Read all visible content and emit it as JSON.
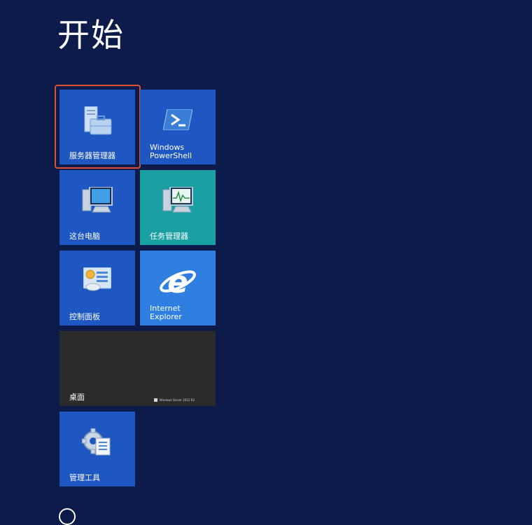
{
  "start": {
    "title": "开始"
  },
  "tiles": {
    "server_manager": {
      "label": "服务器管理器"
    },
    "powershell": {
      "label_line1": "Windows",
      "label_line2": "PowerShell"
    },
    "this_pc": {
      "label": "这台电脑"
    },
    "task_manager": {
      "label": "任务管理器"
    },
    "control_panel": {
      "label": "控制面板"
    },
    "internet_explorer": {
      "label_line1": "Internet",
      "label_line2": "Explorer"
    },
    "desktop": {
      "label": "桌面",
      "os_version": "Windows Server 2012 R2"
    },
    "admin_tools": {
      "label": "管理工具"
    }
  },
  "icons": {
    "server_manager": "server-manager-icon",
    "powershell": "powershell-icon",
    "this_pc": "computer-icon",
    "task_manager": "task-manager-icon",
    "control_panel": "control-panel-icon",
    "internet_explorer": "ie-icon",
    "admin_tools": "admin-tools-icon"
  },
  "colors": {
    "background": "#0d1b4a",
    "tile_blue": "#1e56c2",
    "tile_teal": "#1a9fa2",
    "tile_ie": "#2f7fe0",
    "tile_desktop": "#2b2b2b",
    "selection_outline": "#e0522e"
  }
}
